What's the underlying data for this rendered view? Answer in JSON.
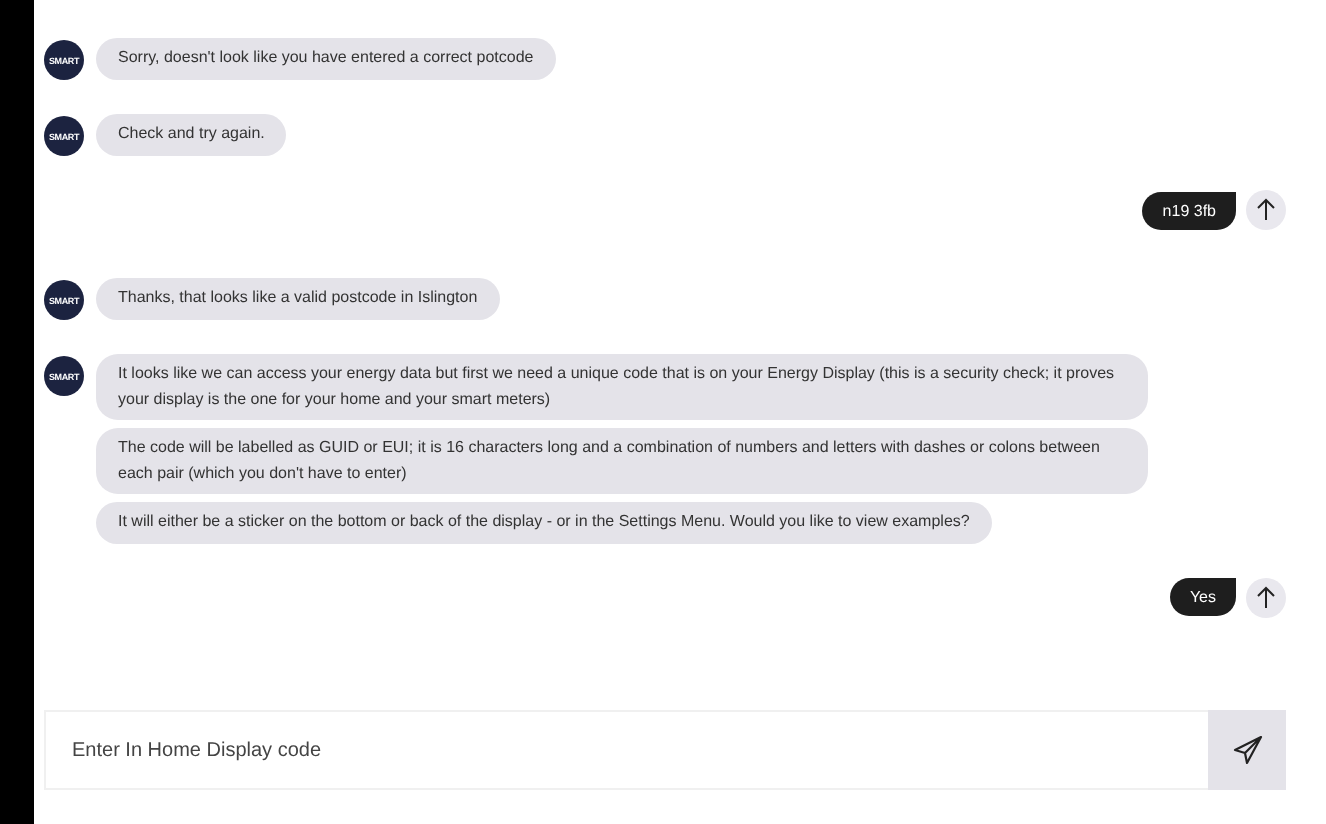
{
  "messages": [
    {
      "kind": "bot",
      "avatar": "SMART",
      "bubbles": [
        "Sorry, doesn't look like you have entered a correct potcode"
      ]
    },
    {
      "kind": "bot",
      "avatar": "SMART",
      "bubbles": [
        "Check and try again."
      ]
    },
    {
      "kind": "user",
      "text": "n19 3fb"
    },
    {
      "kind": "bot",
      "avatar": "SMART",
      "bubbles": [
        "Thanks, that looks like a valid postcode in Islington"
      ]
    },
    {
      "kind": "bot",
      "avatar": "SMART",
      "bubbles": [
        "It looks like we can access your energy data but first we need a unique code that is on your Energy Display (this is a security check; it proves your display is the one for your home and your smart meters)",
        "The code will be labelled as GUID or EUI; it is 16 characters long and a combination of numbers and letters with dashes or colons between each pair (which you don't have to enter)",
        "It will either be a sticker on the bottom or back of the display - or in the Settings Menu. Would you like to view examples?"
      ]
    },
    {
      "kind": "user",
      "text": "Yes"
    }
  ],
  "input": {
    "placeholder": "Enter In Home Display code"
  }
}
